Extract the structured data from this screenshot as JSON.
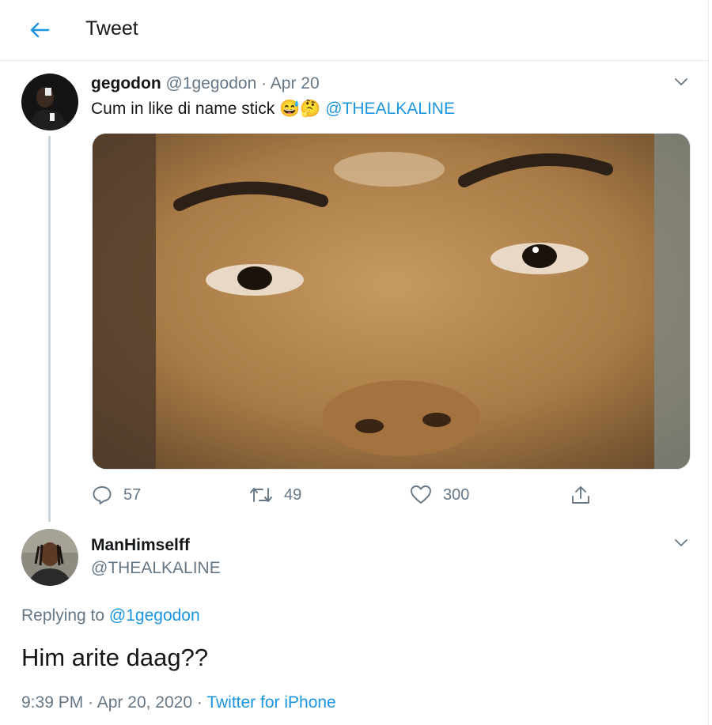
{
  "header": {
    "title": "Tweet"
  },
  "tweet": {
    "author_name": "gegodon",
    "author_handle": "@1gegodon",
    "separator": "·",
    "date": "Apr 20",
    "text": "Cum in like di name stick",
    "emojis": [
      "😅",
      "🤔"
    ],
    "mention": "@THEALKALINE",
    "stats": {
      "replies": "57",
      "retweets": "49",
      "likes": "300"
    }
  },
  "reply": {
    "author_name": "ManHimselff",
    "author_handle": "@THEALKALINE",
    "replying_prefix": "Replying to",
    "replying_to": "@1gegodon",
    "text": "Him arite daag??",
    "time": "9:39 PM",
    "separator": "·",
    "date": "Apr 20, 2020",
    "source": "Twitter for iPhone"
  },
  "icons": [
    "back-arrow-icon",
    "chevron-down-icon",
    "reply-icon",
    "retweet-icon",
    "like-icon",
    "share-icon"
  ],
  "colors": {
    "link": "#1b95e0",
    "muted": "#657786",
    "text": "#14171a",
    "border": "#e6ecf0"
  }
}
